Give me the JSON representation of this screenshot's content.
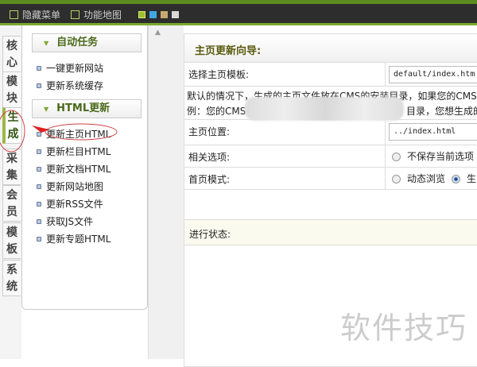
{
  "topbar": {
    "hide_menu": "隐藏菜单",
    "function_map": "功能地图",
    "swatches": [
      "#9ac030",
      "#40a8e0",
      "#c8a870",
      "#d8d8d8"
    ]
  },
  "tabs": [
    "核心",
    "模块",
    "生成",
    "采集",
    "会员",
    "模板",
    "系统"
  ],
  "active_tab": "生成",
  "menu": {
    "groups": [
      {
        "title": "自动任务",
        "items": [
          "一键更新网站",
          "更新系统缓存"
        ]
      },
      {
        "title": "HTML更新",
        "items": [
          "更新主页HTML",
          "更新栏目HTML",
          "更新文档HTML",
          "更新网站地图",
          "更新RSS文件",
          "获取JS文件",
          "更新专题HTML"
        ]
      }
    ]
  },
  "main": {
    "title": "主页更新向导:",
    "template_label": "选择主页模板:",
    "template_value": "default/index.htm",
    "desc_line1": "默认的情况下，生成的主页文件放在CMS的安装目录，如果您的CMS不是",
    "desc_line2a": "例：您的CMS",
    "desc_line2b": "目录，您想生成的",
    "location_label": "主页位置:",
    "location_value": "../index.html",
    "options_label": "相关选项:",
    "options_radio": "不保存当前选项",
    "mode_label": "首页模式:",
    "mode_dynamic": "动态浏览",
    "mode_static": "生",
    "status_label": "进行状态:"
  },
  "watermark": "软件技巧"
}
